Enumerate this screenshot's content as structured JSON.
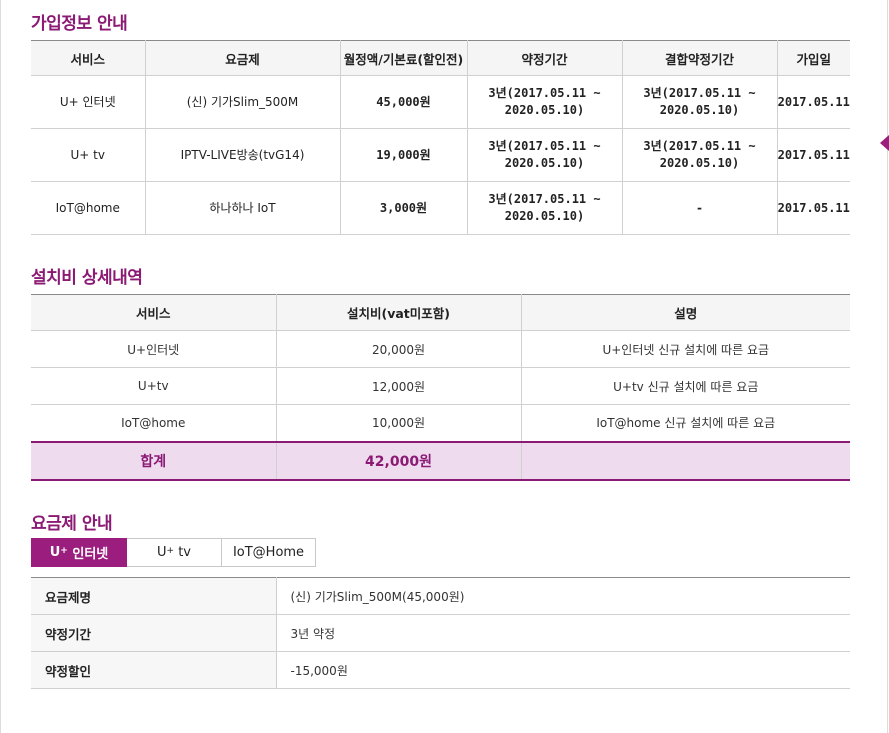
{
  "subscription": {
    "title": "가입정보 안내",
    "headers": [
      "서비스",
      "요금제",
      "월정액/기본료(할인전)",
      "약정기간",
      "결합약정기간",
      "가입일"
    ],
    "rows": [
      {
        "service": "U+ 인터넷",
        "plan": "(신) 기가Slim_500M",
        "fee": "45,000원",
        "term_line1": "3년(2017.05.11 ~",
        "term_line2": "2020.05.10)",
        "bundle_line1": "3년(2017.05.11 ~",
        "bundle_line2": "2020.05.10)",
        "joined": "2017.05.11"
      },
      {
        "service": "U+ tv",
        "plan": "IPTV-LIVE방송(tvG14)",
        "fee": "19,000원",
        "term_line1": "3년(2017.05.11 ~",
        "term_line2": "2020.05.10)",
        "bundle_line1": "3년(2017.05.11 ~",
        "bundle_line2": "2020.05.10)",
        "joined": "2017.05.11"
      },
      {
        "service": "IoT@home",
        "plan": "하나하나 IoT",
        "fee": "3,000원",
        "term_line1": "3년(2017.05.11 ~",
        "term_line2": "2020.05.10)",
        "bundle_line1": "-",
        "bundle_line2": "",
        "joined": "2017.05.11"
      }
    ]
  },
  "installation": {
    "title": "설치비 상세내역",
    "headers": [
      "서비스",
      "설치비(vat미포함)",
      "설명"
    ],
    "rows": [
      {
        "service": "U+인터넷",
        "fee": "20,000원",
        "desc": "U+인터넷 신규 설치에 따른 요금"
      },
      {
        "service": "U+tv",
        "fee": "12,000원",
        "desc": "U+tv 신규 설치에 따른 요금"
      },
      {
        "service": "IoT@home",
        "fee": "10,000원",
        "desc": "IoT@home 신규 설치에 따른 요금"
      }
    ],
    "total_label": "합계",
    "total_value": "42,000원"
  },
  "plan_info": {
    "title": "요금제 안내",
    "tabs": [
      {
        "base": "U",
        "sup": "+",
        "rest": " 인터넷"
      },
      {
        "base": "U",
        "sup": "+",
        "rest": " tv"
      },
      {
        "base": "IoT@Home",
        "sup": "",
        "rest": ""
      }
    ],
    "rows": [
      {
        "label": "요금제명",
        "value": "(신) 기가Slim_500M(45,000원)"
      },
      {
        "label": "약정기간",
        "value": "3년 약정"
      },
      {
        "label": "약정할인",
        "value": "-15,000원"
      }
    ]
  },
  "colors": {
    "accent": "#9b1e7e",
    "total_bg": "#efdbee"
  }
}
